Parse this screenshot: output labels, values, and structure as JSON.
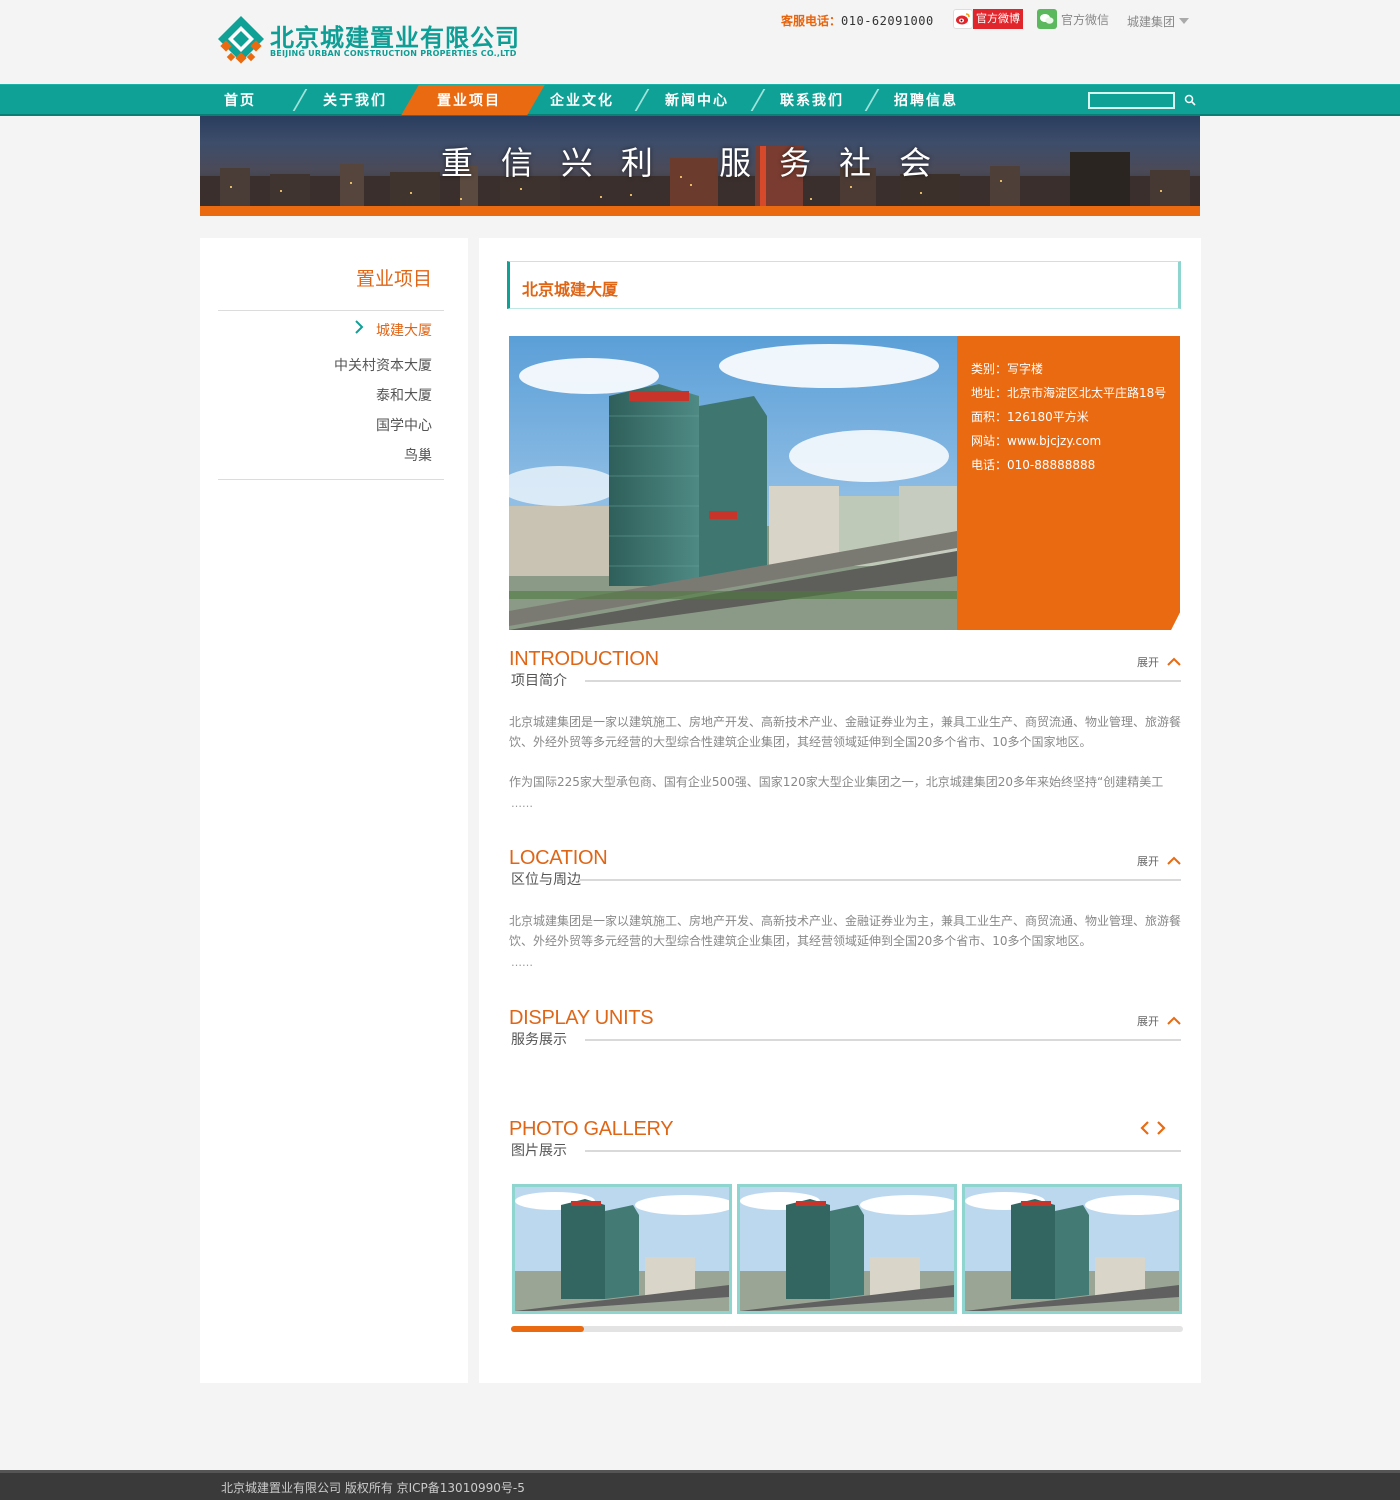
{
  "header": {
    "logo_cn": "北京城建置业有限公司",
    "logo_en": "BEIJING URBAN CONSTRUCTION PROPERTIES CO.,LTD",
    "hotline_label": "客服电话：",
    "hotline_number": "010-62091000",
    "weibo_label": "官方微博",
    "wechat_label": "官方微信",
    "group_label": "城建集团"
  },
  "nav": {
    "items": [
      "首页",
      "关于我们",
      "置业项目",
      "企业文化",
      "新闻中心",
      "联系我们",
      "招聘信息"
    ],
    "active_index": 2,
    "search_placeholder": ""
  },
  "banner": {
    "slogan": "重信兴利 服务社会"
  },
  "sidebar": {
    "title": "置业项目",
    "items": [
      "城建大厦",
      "中关村资本大厦",
      "泰和大厦",
      "国学中心",
      "鸟巢"
    ],
    "active_index": 0
  },
  "project": {
    "title": "北京城建大厦",
    "info": {
      "type": "类别：写字楼",
      "address": "地址：北京市海淀区北太平庄路18号",
      "area": "面积：126180平方米",
      "website": "网站：www.bjcjzy.com",
      "phone": "电话：010-88888888"
    }
  },
  "sections": {
    "toggle_label": "展开",
    "intro": {
      "en": "INTRODUCTION",
      "cn": "项目简介",
      "p1": "北京城建集团是一家以建筑施工、房地产开发、高新技术产业、金融证券业为主，兼具工业生产、商贸流通、物业管理、旅游餐饮、外经外贸等多元经营的大型综合性建筑企业集团，其经营领域延伸到全国20多个省市、10多个国家地区。",
      "p2": "作为国际225家大型承包商、国有企业500强、国家120家大型企业集团之一，北京城建集团20多年来始终坚持“创建精美工",
      "dots": "……"
    },
    "location": {
      "en": "LOCATION",
      "cn": "区位与周边",
      "p1": "北京城建集团是一家以建筑施工、房地产开发、高新技术产业、金融证券业为主，兼具工业生产、商贸流通、物业管理、旅游餐饮、外经外贸等多元经营的大型综合性建筑企业集团，其经营领域延伸到全国20多个省市、10多个国家地区。",
      "dots": "……"
    },
    "display": {
      "en": "DISPLAY UNITS",
      "cn": "服务展示"
    },
    "gallery": {
      "en": "PHOTO GALLERY",
      "cn": "图片展示",
      "thumb_count": 3,
      "scroll_position": 0.11
    }
  },
  "footer": {
    "text": "北京城建置业有限公司 版权所有  京ICP备13010990号-5"
  },
  "colors": {
    "teal": "#0fa196",
    "orange": "#e96a10",
    "footer_bg": "#3a3a3a"
  }
}
